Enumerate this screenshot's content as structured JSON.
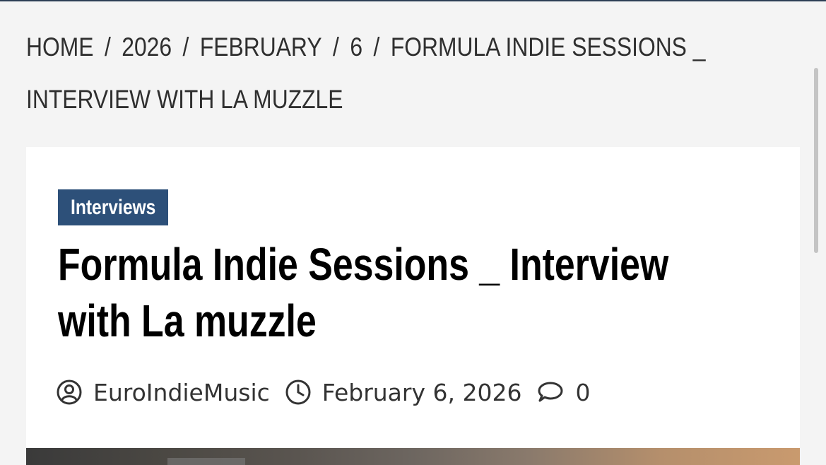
{
  "breadcrumb": {
    "items": [
      "HOME",
      "2026",
      "FEBRUARY",
      "6",
      "FORMULA INDIE SESSIONS _ INTERVIEW WITH LA MUZZLE"
    ],
    "separator": "/"
  },
  "article": {
    "category": "Interviews",
    "title": "Formula Indie Sessions _ Interview with La muzzle",
    "author": "EuroIndieMusic",
    "date": "February 6, 2026",
    "comments": "0"
  },
  "colors": {
    "category_bg": "#2d5079",
    "page_bg": "#f4f4f4",
    "card_bg": "#ffffff"
  },
  "icons": {
    "author": "user-circle-icon",
    "date": "clock-icon",
    "comments": "comment-icon"
  }
}
